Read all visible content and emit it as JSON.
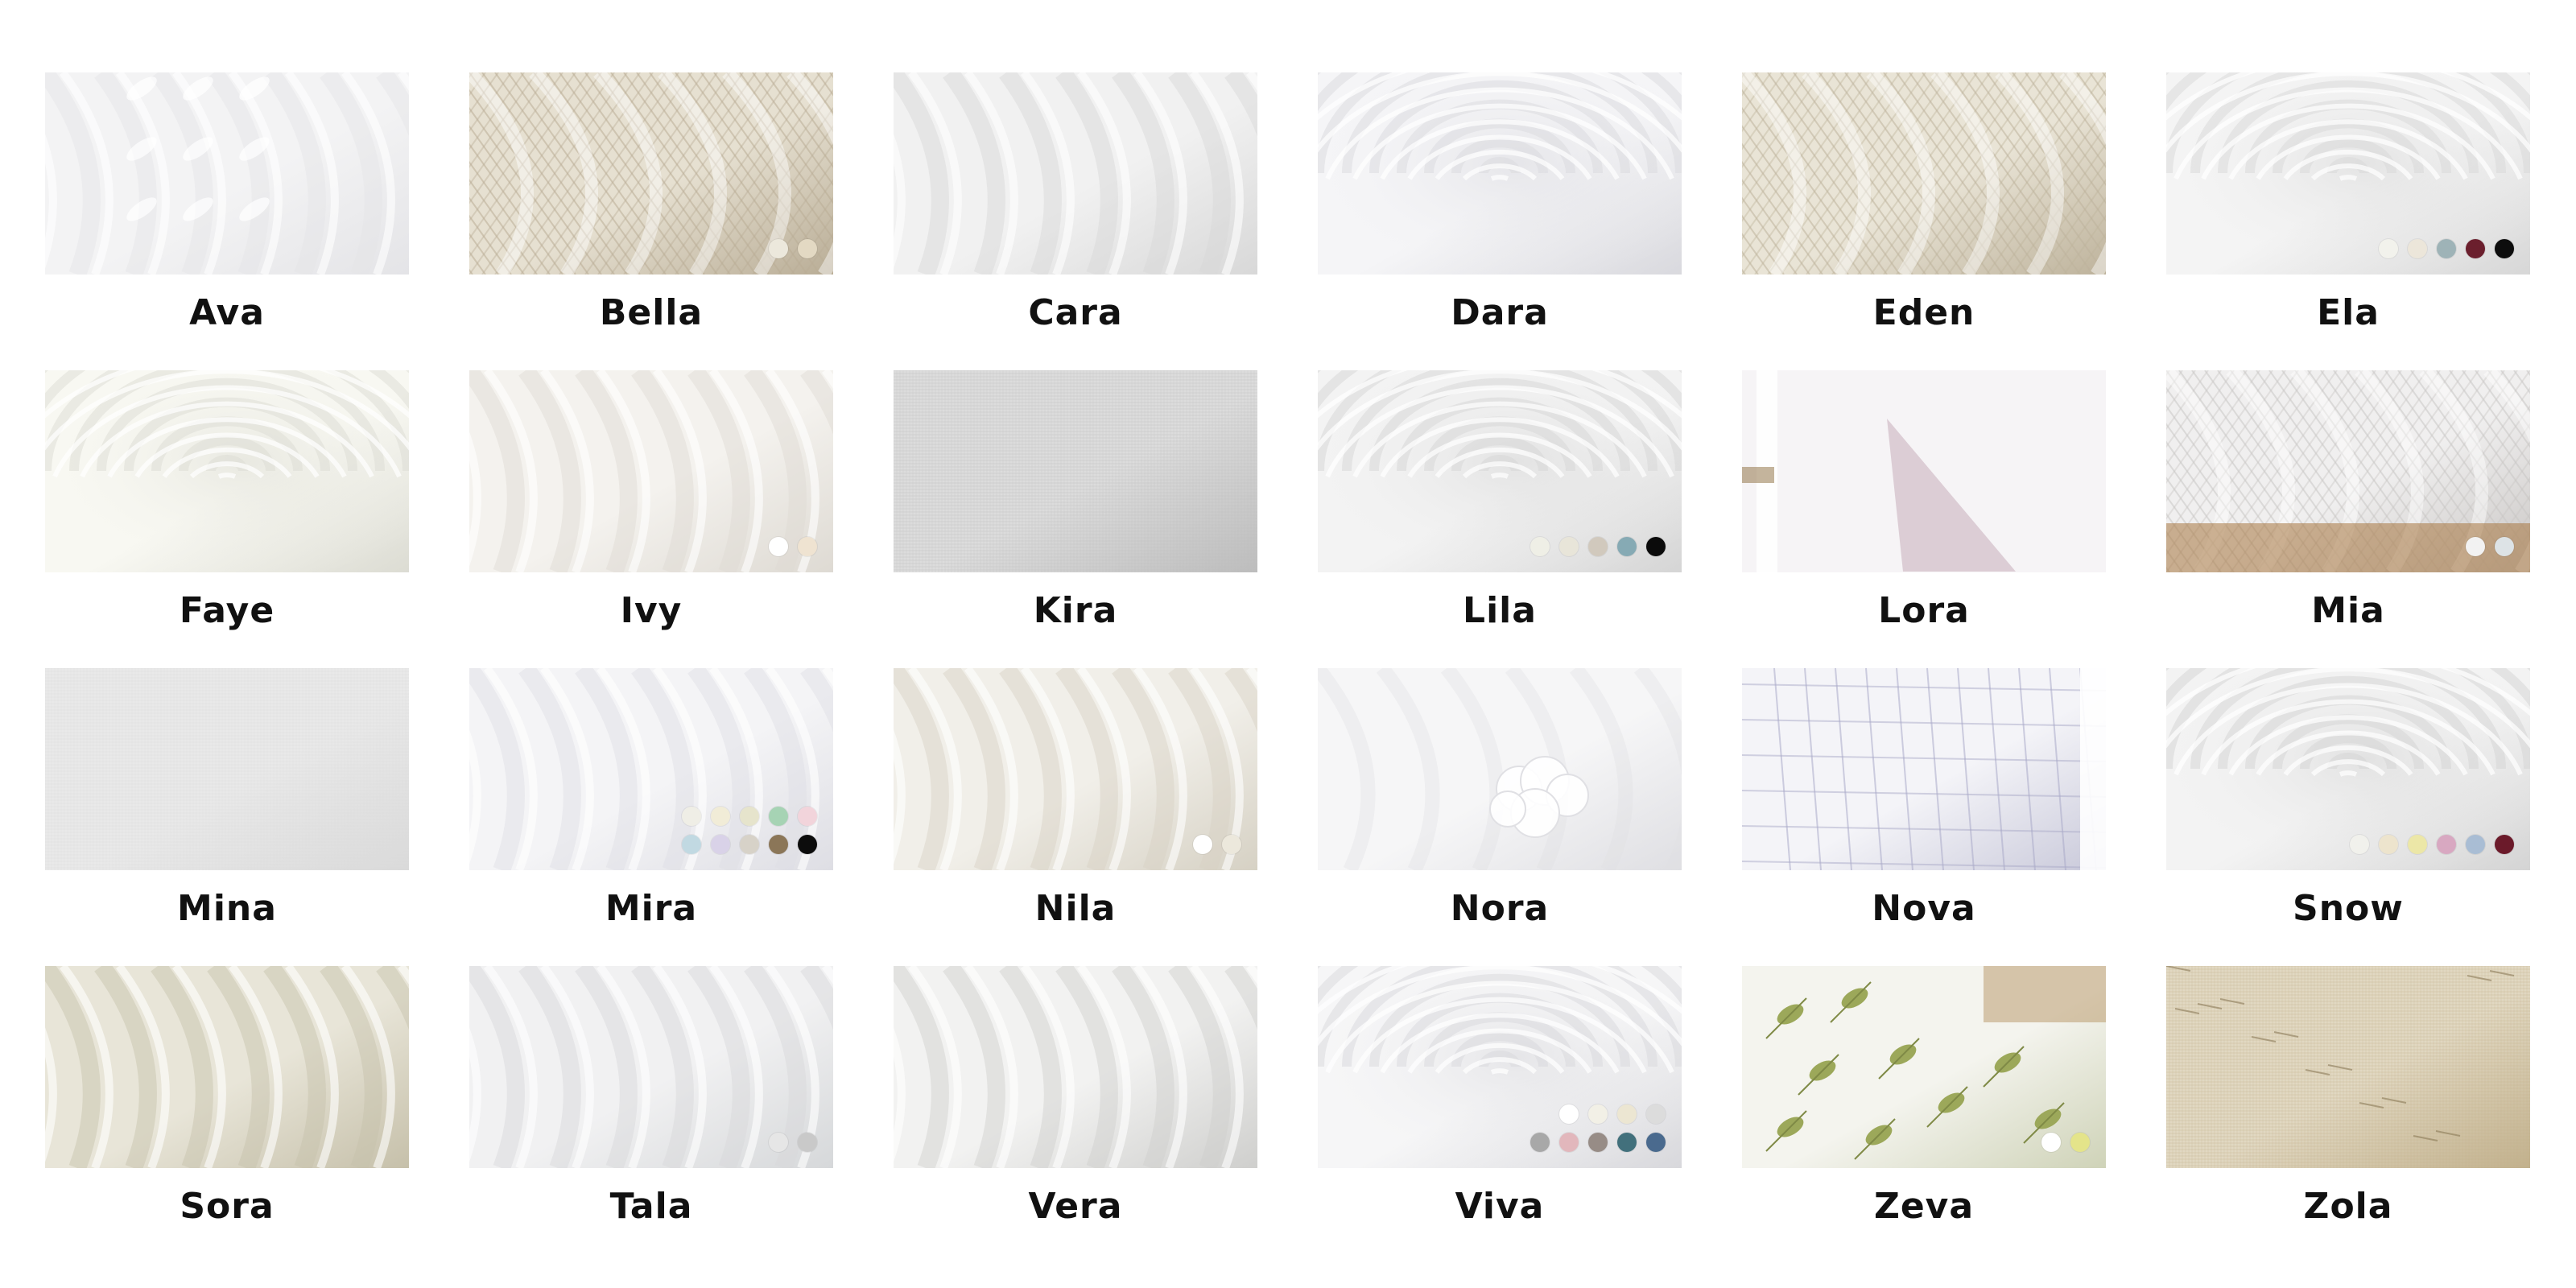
{
  "products": [
    {
      "name": "Ava",
      "texture": "leaf-sheer",
      "base": [
        "#f3f3f4",
        "#e4e4e7"
      ],
      "colors": []
    },
    {
      "name": "Bella",
      "texture": "mesh",
      "base": [
        "#e6e0d1",
        "#b9ad96"
      ],
      "colors": [
        "#ece8dc",
        "#e3d9c3"
      ]
    },
    {
      "name": "Cara",
      "texture": "folds",
      "base": [
        "#f1f1f1",
        "#d8d8d8"
      ],
      "colors": []
    },
    {
      "name": "Dara",
      "texture": "swirl",
      "base": [
        "#f5f5f7",
        "#d9d9de"
      ],
      "colors": []
    },
    {
      "name": "Eden",
      "texture": "mesh",
      "base": [
        "#e9e4d6",
        "#beb39c"
      ],
      "colors": []
    },
    {
      "name": "Ela",
      "texture": "swirl",
      "base": [
        "#f4f4f4",
        "#d7d7d7"
      ],
      "colors": [
        "#f2f2ec",
        "#ece6da",
        "#9eb3b7",
        "#6b1f2d",
        "#0d0d0d"
      ]
    },
    {
      "name": "Faye",
      "texture": "swirl",
      "base": [
        "#f8f8f2",
        "#dcdcd3"
      ],
      "colors": []
    },
    {
      "name": "Ivy",
      "texture": "folds",
      "base": [
        "#f4f2ee",
        "#dedad3"
      ],
      "colors": [
        "#ffffff",
        "#efe3d1"
      ]
    },
    {
      "name": "Kira",
      "texture": "linen",
      "base": [
        "#dcdcdc",
        "#bdbdbd"
      ],
      "colors": []
    },
    {
      "name": "Lila",
      "texture": "swirl",
      "base": [
        "#f3f3f3",
        "#d5d5d5"
      ],
      "colors": [
        "#efefe6",
        "#e8e5d9",
        "#d1c9bd",
        "#86aab4",
        "#0b0b0b"
      ]
    },
    {
      "name": "Lora",
      "texture": "window",
      "base": [
        "#f3f1f3",
        "#dccbd3"
      ],
      "colors": []
    },
    {
      "name": "Mia",
      "texture": "mesh-basket",
      "base": [
        "#f0efef",
        "#c9c6c4"
      ],
      "colors": [
        "#f2f2f2",
        "#dde3e6"
      ]
    },
    {
      "name": "Mina",
      "texture": "linen",
      "base": [
        "#e9e9e9",
        "#dadada"
      ],
      "colors": []
    },
    {
      "name": "Mira",
      "texture": "folds",
      "base": [
        "#f4f4f6",
        "#dedee4"
      ],
      "colors": [
        "#efeee6",
        "#f1ecd7",
        "#e6e4cc",
        "#a6d3b4",
        "#f2d4db",
        "#c1d9e2",
        "#d9d2e8",
        "#d7d2c8",
        "#8b7658",
        "#0c0c0c"
      ]
    },
    {
      "name": "Nila",
      "texture": "folds",
      "base": [
        "#f1efe9",
        "#d6d1c4"
      ],
      "colors": [
        "#ffffff",
        "#ece8dc"
      ]
    },
    {
      "name": "Nora",
      "texture": "cloud",
      "base": [
        "#f6f6f7",
        "#dfdfe3"
      ],
      "colors": []
    },
    {
      "name": "Nova",
      "texture": "plaid",
      "base": [
        "#f4f4f8",
        "#c9c9da"
      ],
      "colors": []
    },
    {
      "name": "Snow",
      "texture": "swirl",
      "base": [
        "#f3f3f3",
        "#d4d4d4"
      ],
      "colors": [
        "#f1f1ec",
        "#ede4cd",
        "#ece7a7",
        "#d8a8c1",
        "#a9bdd4",
        "#6b1a2a"
      ]
    },
    {
      "name": "Sora",
      "texture": "folds",
      "base": [
        "#e8e5d8",
        "#c6c0aa"
      ],
      "colors": []
    },
    {
      "name": "Tala",
      "texture": "folds",
      "base": [
        "#f1f1f2",
        "#d6d8da"
      ],
      "colors": [
        "#e6e6e6",
        "#c9c9c9"
      ]
    },
    {
      "name": "Vera",
      "texture": "folds",
      "base": [
        "#f2f2f1",
        "#cfcfcd"
      ],
      "colors": []
    },
    {
      "name": "Viva",
      "texture": "swirl",
      "base": [
        "#f6f6f7",
        "#d8d8dc"
      ],
      "colors": [
        "#ffffff",
        "#f2f0e6",
        "#ece6d2",
        "#dcdcdc",
        "#a8a8a8",
        "#e2b7bc",
        "#978c86",
        "#42707c",
        "#4a6a8e"
      ]
    },
    {
      "name": "Zeva",
      "texture": "leaf-embroidery",
      "base": [
        "#f4f4ee",
        "#cfd3b8"
      ],
      "colors": [
        "#ffffff",
        "#e4e48a"
      ]
    },
    {
      "name": "Zola",
      "texture": "linen-slub",
      "base": [
        "#e1d8c2",
        "#c2b18d"
      ],
      "colors": []
    }
  ]
}
